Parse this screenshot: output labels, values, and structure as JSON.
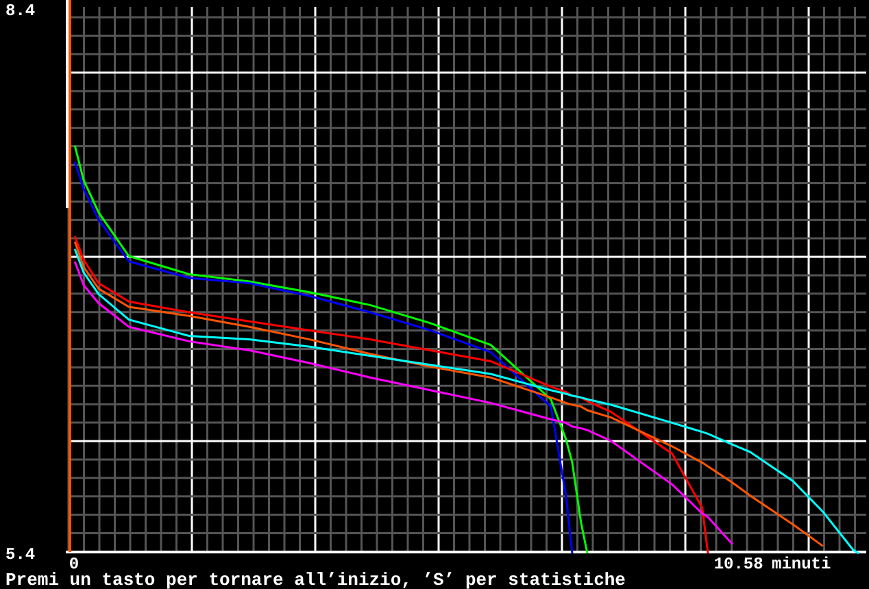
{
  "chart": {
    "chart_data": {
      "type": "line",
      "x": [
        0.1,
        0.24,
        0.48,
        0.96,
        1.92,
        2.88,
        3.84,
        4.8,
        5.76,
        6.72,
        7.68,
        7.92,
        8.02,
        8.16,
        8.26,
        8.64,
        9.61,
        10.09,
        10.18,
        10.57,
        10.85,
        11.53,
        12.01,
        12.49,
        12.58
      ],
      "series": [
        {
          "color": "#00ff00",
          "values": [
            7.65,
            7.46,
            7.28,
            7.04,
            6.94,
            6.9,
            6.84,
            6.77,
            6.67,
            6.55,
            6.25,
            6.03,
            5.9,
            5.57,
            5.4,
            null,
            null,
            null,
            null,
            null,
            null,
            null,
            null,
            null,
            null
          ]
        },
        {
          "color": "#0000ff",
          "values": [
            7.56,
            7.41,
            7.24,
            7.01,
            6.92,
            6.89,
            6.82,
            6.73,
            6.63,
            6.51,
            6.21,
            5.72,
            5.4,
            null,
            null,
            null,
            null,
            null,
            null,
            null,
            null,
            null,
            null,
            null,
            null
          ]
        },
        {
          "color": "#ff0000",
          "values": [
            7.15,
            7.02,
            6.89,
            6.79,
            6.73,
            6.68,
            6.63,
            6.58,
            6.52,
            6.46,
            6.32,
            6.29,
            6.27,
            6.26,
            6.24,
            6.18,
            5.95,
            5.65,
            5.4,
            null,
            null,
            null,
            null,
            null,
            null
          ]
        },
        {
          "color": "#ff5500",
          "values": [
            7.12,
            6.98,
            6.86,
            6.76,
            6.71,
            6.65,
            6.58,
            6.5,
            6.43,
            6.37,
            6.26,
            6.23,
            6.22,
            6.21,
            6.19,
            6.15,
            5.99,
            5.9,
            5.88,
            5.79,
            5.72,
            5.56,
            5.44,
            null,
            null
          ]
        },
        {
          "color": "#00ffff",
          "values": [
            7.08,
            6.95,
            6.83,
            6.69,
            6.6,
            6.58,
            6.54,
            6.49,
            6.44,
            6.39,
            6.3,
            6.28,
            6.27,
            6.26,
            6.25,
            6.22,
            6.12,
            6.07,
            6.06,
            6.0,
            5.96,
            5.8,
            5.63,
            5.42,
            5.4
          ]
        },
        {
          "color": "#ff00ff",
          "values": [
            7.01,
            6.88,
            6.78,
            6.65,
            6.57,
            6.52,
            6.45,
            6.37,
            6.3,
            6.23,
            6.14,
            6.12,
            6.1,
            6.09,
            6.08,
            6.02,
            5.78,
            5.62,
            5.6,
            5.45,
            null,
            null,
            null,
            null,
            null
          ]
        }
      ],
      "xlim": [
        0,
        12.7
      ],
      "ylim": [
        5.4,
        8.4
      ],
      "xlabel": "minuti",
      "xticks": [
        {
          "value": 0,
          "label": "0"
        },
        {
          "value": 10.58,
          "label": "10.58"
        }
      ],
      "yticks": [
        {
          "value": 8.4,
          "label": "8.4"
        },
        {
          "value": 5.4,
          "label": "5.4"
        }
      ]
    }
  },
  "status_line": "Premi un tasto per tornare all’inizio, ’S’ per statistiche"
}
